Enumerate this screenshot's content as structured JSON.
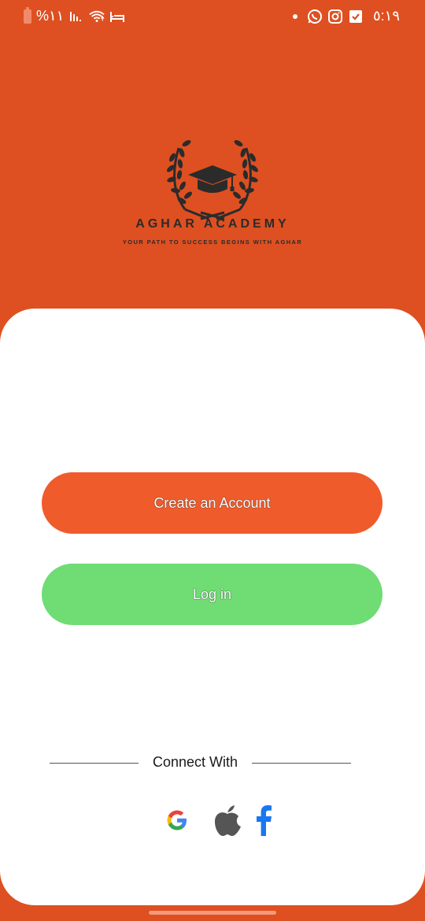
{
  "status_bar": {
    "battery_text": "%١١",
    "time": "٥:١٩",
    "left_icons": [
      "battery-icon",
      "signal-icon",
      "wifi-icon",
      "bed-icon"
    ],
    "right_icons": [
      "notification-dot-icon",
      "whatsapp-icon",
      "instagram-icon",
      "checkbox-icon"
    ]
  },
  "brand": {
    "name": "AGHAR ACADEMY",
    "tagline": "YOUR PATH TO SUCCESS BEGINS WITH AGHAR",
    "logo_icon": "graduation-cap-laurel-icon"
  },
  "actions": {
    "create_account_label": "Create an Account",
    "login_label": "Log in"
  },
  "connect": {
    "label": "Connect With",
    "providers": [
      "google-icon",
      "apple-icon",
      "facebook-icon"
    ]
  },
  "colors": {
    "background": "#de5021",
    "create_button": "#f05b2b",
    "login_button": "#6fdc74",
    "card": "#ffffff",
    "logo_dark": "#2b2b2b",
    "facebook_blue": "#1877f2",
    "apple_gray": "#555555"
  }
}
